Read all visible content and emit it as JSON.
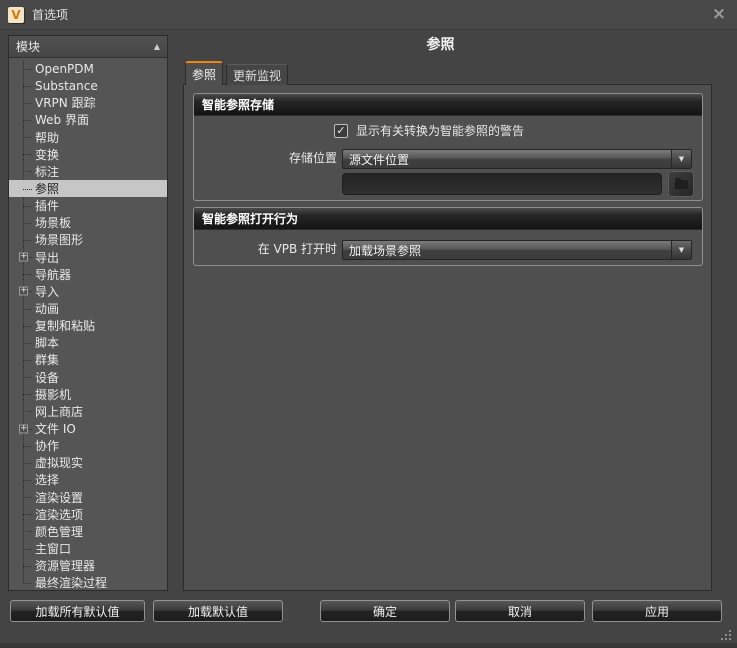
{
  "window": {
    "title": "首选项",
    "logo_text": "V"
  },
  "icons": {
    "close": "×",
    "collapse_up": "▲",
    "dropdown_arrow": "▼",
    "check": "✓",
    "expand_plus": "+"
  },
  "colors": {
    "accent_orange": "#ed8615",
    "selection_bg": "#c6c6c6",
    "panel_bg": "#4f4f4f",
    "sidebar_bg": "#555555",
    "group_header_dark": "#131313"
  },
  "sidebar": {
    "header": "模块",
    "items": [
      {
        "label": "OpenPDM"
      },
      {
        "label": "Substance"
      },
      {
        "label": "VRPN 跟踪"
      },
      {
        "label": "Web 界面"
      },
      {
        "label": "帮助"
      },
      {
        "label": "变换"
      },
      {
        "label": "标注"
      },
      {
        "label": "参照",
        "selected": true
      },
      {
        "label": "插件"
      },
      {
        "label": "场景板"
      },
      {
        "label": "场景图形"
      },
      {
        "label": "导出",
        "expandable": true
      },
      {
        "label": "导航器"
      },
      {
        "label": "导入",
        "expandable": true
      },
      {
        "label": "动画"
      },
      {
        "label": "复制和粘贴"
      },
      {
        "label": "脚本"
      },
      {
        "label": "群集"
      },
      {
        "label": "设备"
      },
      {
        "label": "摄影机"
      },
      {
        "label": "网上商店"
      },
      {
        "label": "文件 IO",
        "expandable": true
      },
      {
        "label": "协作"
      },
      {
        "label": "虚拟现实"
      },
      {
        "label": "选择"
      },
      {
        "label": "渲染设置"
      },
      {
        "label": "渲染选项"
      },
      {
        "label": "颜色管理"
      },
      {
        "label": "主窗口"
      },
      {
        "label": "资源管理器"
      },
      {
        "label": "最终渲染过程"
      }
    ]
  },
  "main": {
    "page_title": "参照",
    "tabs": [
      {
        "label": "参照",
        "active": true
      },
      {
        "label": "更新监视",
        "active": false
      }
    ],
    "groups": [
      {
        "title": "智能参照存储",
        "checkbox": {
          "label": "显示有关转换为智能参照的警告",
          "checked": true
        },
        "storage_location": {
          "label": "存储位置",
          "value": "源文件位置"
        },
        "path_field": {
          "value": ""
        }
      },
      {
        "title": "智能参照打开行为",
        "open_behavior": {
          "label": "在 VPB 打开时",
          "value": "加载场景参照"
        }
      }
    ]
  },
  "footer": {
    "buttons": [
      "加载所有默认值",
      "加载默认值",
      "确定",
      "取消",
      "应用"
    ]
  }
}
